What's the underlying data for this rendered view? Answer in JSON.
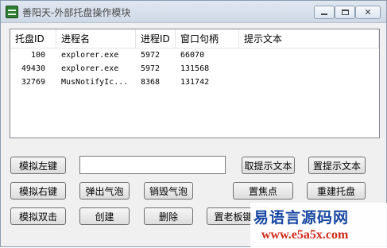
{
  "window": {
    "title": "善阳天-外部托盘操作模块",
    "controls": {
      "minimize": "min-icon",
      "maximize": "max-icon",
      "close": "✕"
    }
  },
  "listview": {
    "columns": [
      "托盘ID",
      "进程名",
      "进程ID",
      "窗口句柄",
      "提示文本"
    ],
    "rows": [
      [
        "100",
        "explorer.exe",
        "5972",
        "66070",
        ""
      ],
      [
        "49430",
        "explorer.exe",
        "5972",
        "131568",
        ""
      ],
      [
        "32769",
        "MusNotifyIc...",
        "8368",
        "131742",
        ""
      ]
    ]
  },
  "buttons": {
    "simulate_left": "模拟左键",
    "simulate_right": "模拟右键",
    "simulate_double": "模拟双击",
    "popup_balloon": "弹出气泡",
    "destroy_balloon": "销毁气泡",
    "create": "创建",
    "delete": "删除",
    "get_tip": "取提示文本",
    "set_tip": "置提示文本",
    "set_focus": "置焦点",
    "rebuild_tray": "重建托盘",
    "set_boss_key": "置老板键(A"
  },
  "input": {
    "value": ""
  },
  "watermark": {
    "line1": "易语言源码网",
    "line2": "www.e5a5x.com"
  }
}
